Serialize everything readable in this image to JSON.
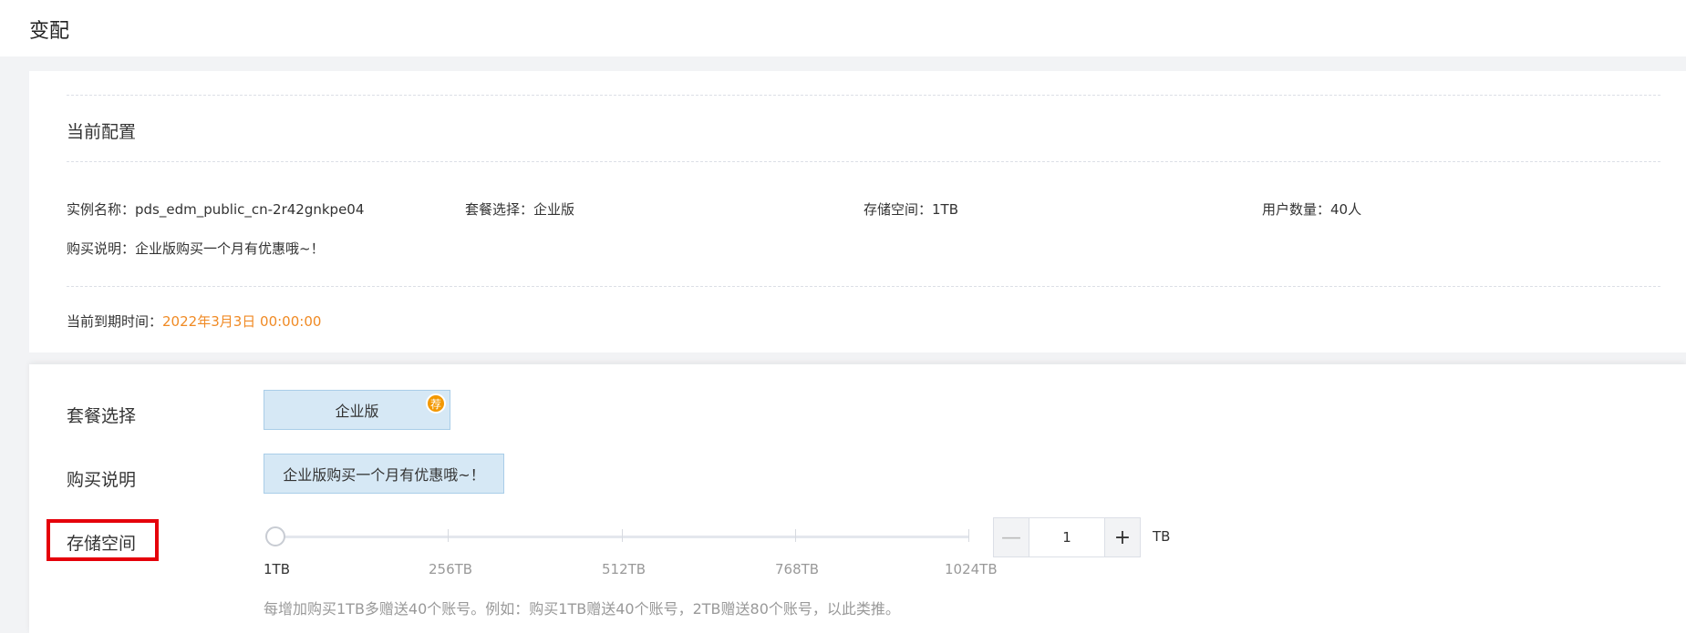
{
  "page": {
    "title": "变配"
  },
  "current": {
    "section_title": "当前配置",
    "instance_label": "实例名称：",
    "instance_value": "pds_edm_public_cn-2r42gnkpe04",
    "package_label": "套餐选择：",
    "package_value": "企业版",
    "storage_label": "存储空间：",
    "storage_value": "1TB",
    "users_label": "用户数量：",
    "users_value": "40人",
    "purchase_label": "购买说明：",
    "purchase_value": "企业版购买一个月有优惠哦~！",
    "expire_label": "当前到期时间：",
    "expire_value": "2022年3月3日 00:00:00"
  },
  "form": {
    "package_label": "套餐选择",
    "package_option": "企业版",
    "recommend_badge": "荐",
    "purchase_label": "购买说明",
    "purchase_text": "企业版购买一个月有优惠哦~！",
    "storage_label": "存储空间",
    "slider": {
      "ticks": [
        "1TB",
        "256TB",
        "512TB",
        "768TB",
        "1024TB"
      ],
      "value": "1TB"
    },
    "stepper": {
      "minus": "—",
      "value": "1",
      "plus": "+"
    },
    "unit": "TB",
    "note": "每增加购买1TB多赠送40个账号。例如：购买1TB赠送40个账号，2TB赠送80个账号，以此类推。"
  },
  "colors": {
    "accent_orange": "#f08a24",
    "highlight_red": "#e5000a",
    "option_bg": "#d6e8f5"
  }
}
